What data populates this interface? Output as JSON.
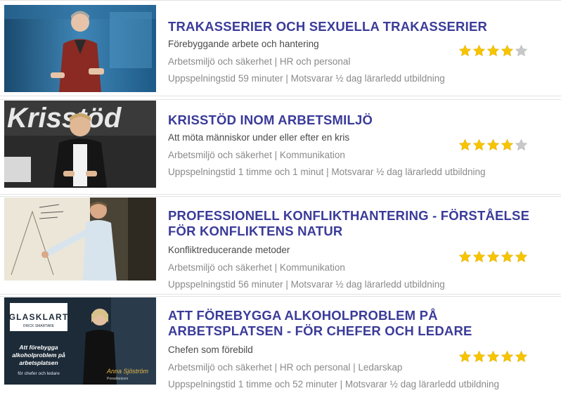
{
  "courses": [
    {
      "title_lines": [
        "TRAKASSERIER OCH SEXUELLA TRAKASSERIER"
      ],
      "subtitle": "Förebyggande arbete och hantering",
      "categories": "Arbetsmiljö och säkerhet | HR och personal",
      "duration": "Uppspelningstid 59 minuter | Motsvarar ½ dag lärarledd utbildning",
      "rating": 4,
      "rating_max": 5,
      "thumbnail_text": ""
    },
    {
      "title_lines": [
        "KRISSTÖD INOM ARBETSMILJÖ"
      ],
      "subtitle": "Att möta människor under eller efter en kris",
      "categories": "Arbetsmiljö och säkerhet | Kommunikation",
      "duration": "Uppspelningstid 1 timme och 1 minut | Motsvarar ½ dag lärarledd utbildning",
      "rating": 4,
      "rating_max": 5,
      "thumbnail_text": "Krisstöd"
    },
    {
      "title_lines": [
        "PROFESSIONELL KONFLIKTHANTERING - FÖRSTÅELSE",
        "FÖR KONFLIKTENS NATUR"
      ],
      "subtitle": "Konfliktreducerande metoder",
      "categories": "Arbetsmiljö och säkerhet | Kommunikation",
      "duration": "Uppspelningstid 56 minuter | Motsvarar ½ dag lärarledd utbildning",
      "rating": 5,
      "rating_max": 5,
      "thumbnail_text": ""
    },
    {
      "title_lines": [
        "ATT FÖREBYGGA ALKOHOLPROBLEM PÅ",
        "ARBETSPLATSEN - FÖR CHEFER OCH LEDARE"
      ],
      "subtitle": "Chefen som förebild",
      "categories": "Arbetsmiljö och säkerhet | HR och personal | Ledarskap",
      "duration": "Uppspelningstid 1 timme och 52 minuter | Motsvarar ½ dag lärarledd utbildning",
      "rating": 5,
      "rating_max": 5,
      "thumbnail_text": "",
      "thumbnail_logo": "GLASKLART",
      "thumbnail_logo_sub": "DRICK SMARTARE",
      "thumbnail_caption_lines": [
        "Att förebygga",
        "alkoholproblem på",
        "arbetsplatsen"
      ],
      "thumbnail_caption_sub": "för chefer och ledare",
      "thumbnail_presenter": "Anna Sjöström",
      "thumbnail_presenter_role": "Prevelitetsom"
    }
  ],
  "colors": {
    "title": "#3b3b9a",
    "star_filled": "#f6c500",
    "star_empty": "#c8c8c8",
    "meta": "#8a8a8a"
  }
}
